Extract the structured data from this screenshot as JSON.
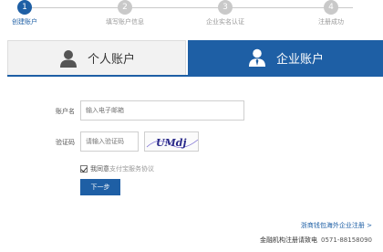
{
  "steps": [
    {
      "num": "1",
      "label": "创建账户"
    },
    {
      "num": "2",
      "label": "填写账户信息"
    },
    {
      "num": "3",
      "label": "企业实名认证"
    },
    {
      "num": "4",
      "label": "注册成功"
    }
  ],
  "tabs": {
    "personal": "个人账户",
    "company": "企业账户"
  },
  "form": {
    "account_label": "账户名",
    "account_placeholder": "输入电子邮箱",
    "captcha_label": "验证码",
    "captcha_placeholder": "请输入验证码",
    "captcha_text": "UMdj",
    "agree_prefix": "我同意",
    "agree_link": "支付宝服务协议",
    "next_label": "下一步"
  },
  "footer": {
    "link": "浙商钱包海外企业注册 >",
    "hotline_label": "金融机构注册请致电",
    "hotline_number": "0571-88158090"
  },
  "colors": {
    "accent": "#1e5fa5",
    "inactive_step": "#c9c9c9"
  }
}
